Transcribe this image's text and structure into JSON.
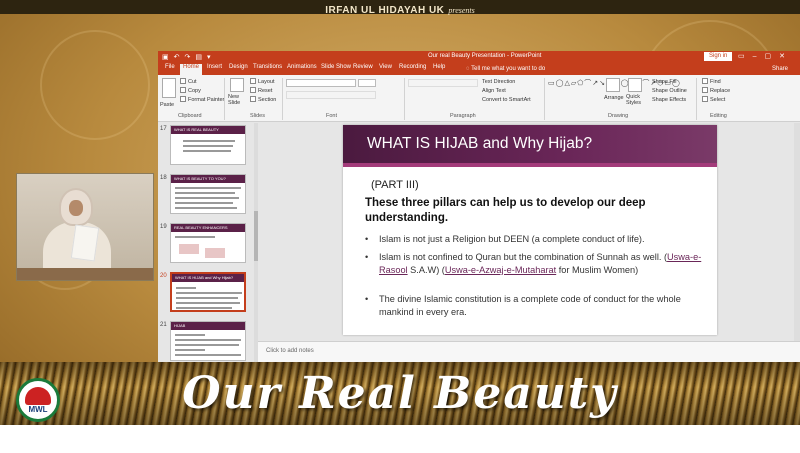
{
  "overlay": {
    "channel": "IRFAN UL HIDAYAH UK",
    "presents": "presents",
    "banner": "Our Real Beauty",
    "logo_text": "MWL"
  },
  "ppt": {
    "title": "Our real Beauty Presentation - PowerPoint",
    "sign_in": "Sign in",
    "tabs": [
      "File",
      "Home",
      "Insert",
      "Design",
      "Transitions",
      "Animations",
      "Slide Show",
      "Review",
      "View",
      "Recording",
      "Help"
    ],
    "tell_me": "Tell me what you want to do",
    "share": "Share",
    "ribbon": {
      "cut": "Cut",
      "copy": "Copy",
      "format_painter": "Format Painter",
      "paste": "Paste",
      "new_slide": "New Slide",
      "layout": "Layout",
      "reset": "Reset",
      "section": "Section",
      "text_direction": "Text Direction",
      "align_text": "Align Text",
      "convert_smartart": "Convert to SmartArt",
      "arrange": "Arrange",
      "quick_styles": "Quick Styles",
      "shape_fill": "Shape Fill",
      "shape_outline": "Shape Outline",
      "shape_effects": "Shape Effects",
      "find": "Find",
      "replace": "Replace",
      "select": "Select",
      "groups": [
        "Clipboard",
        "Slides",
        "Font",
        "Paragraph",
        "Drawing",
        "Editing"
      ]
    },
    "thumbnails": [
      {
        "num": "17",
        "title": "WHAT IS REAL BEAUTY"
      },
      {
        "num": "18",
        "title": "WHAT IS BEAUTY TO YOU?"
      },
      {
        "num": "19",
        "title": "REAL BEAUTY ENHANCERS"
      },
      {
        "num": "20",
        "title": "WHAT IS HIJAB and Why Hijab?"
      },
      {
        "num": "21",
        "title": "HIJAB"
      }
    ],
    "notes_placeholder": "Click to add notes"
  },
  "slide": {
    "title": "WHAT IS HIJAB and Why Hijab?",
    "part": "(PART III)",
    "subtitle": "These three pillars can help us to develop our deep understanding.",
    "bullet1": "Islam is not just a Religion but DEEN (a complete conduct of life).",
    "bullet2_a": "Islam is not confined to Quran but the combination of Sunnah as well. (",
    "bullet2_b": "Uswa-e-Rasool",
    "bullet2_c": " S.A.W) (",
    "bullet2_d": "Uswa-e-Azwaj-e-Mutaharat",
    "bullet2_e": " for Muslim Women)",
    "bullet3": "The divine Islamic constitution is a complete code of conduct for the whole mankind in every era."
  },
  "colors": {
    "ppt_accent": "#c43e1c",
    "slide_header": "#5b2148",
    "banner_text": "#ffffff"
  }
}
